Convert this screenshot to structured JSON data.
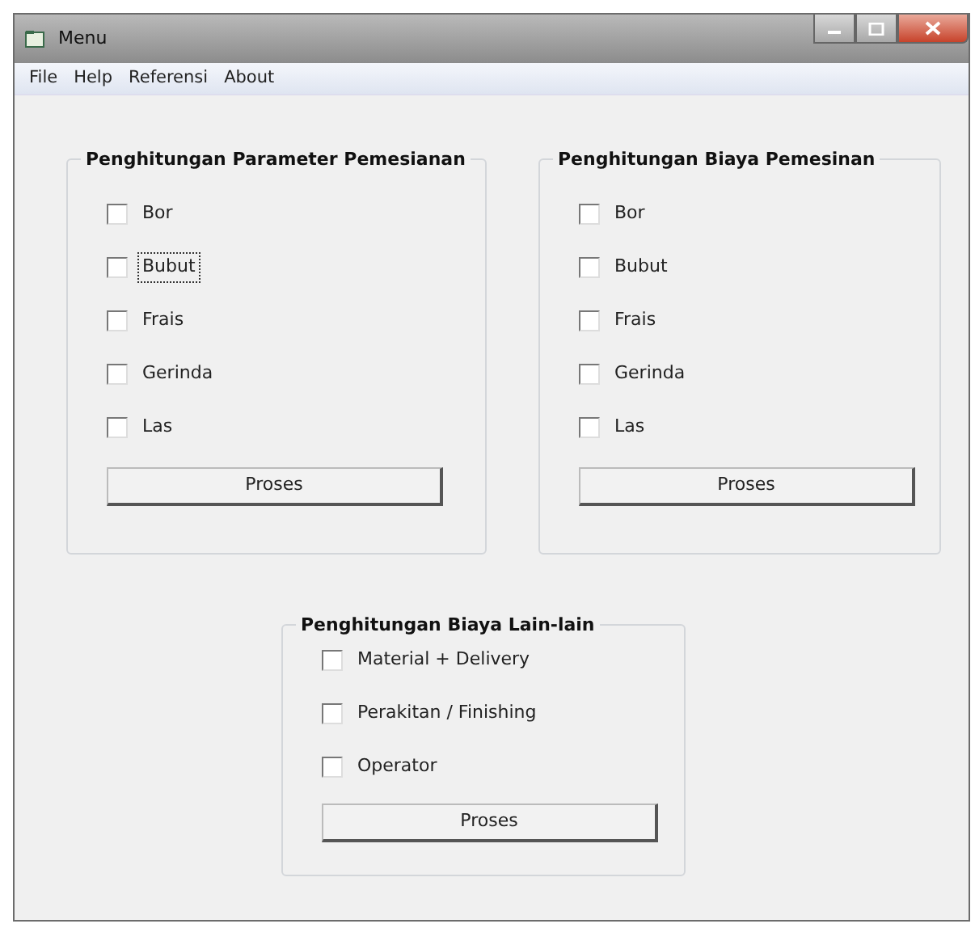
{
  "window": {
    "title": "Menu"
  },
  "menu": [
    "File",
    "Help",
    "Referensi",
    "About"
  ],
  "groups": [
    {
      "title": "Penghitungan Parameter Pemesianan",
      "items": [
        {
          "label": "Bor",
          "checked": false,
          "focused": false
        },
        {
          "label": "Bubut",
          "checked": false,
          "focused": true
        },
        {
          "label": "Frais",
          "checked": false,
          "focused": false
        },
        {
          "label": "Gerinda",
          "checked": false,
          "focused": false
        },
        {
          "label": "Las",
          "checked": false,
          "focused": false
        }
      ],
      "button": "Proses"
    },
    {
      "title": "Penghitungan Biaya Pemesinan",
      "items": [
        {
          "label": "Bor",
          "checked": false,
          "focused": false
        },
        {
          "label": "Bubut",
          "checked": false,
          "focused": false
        },
        {
          "label": "Frais",
          "checked": false,
          "focused": false
        },
        {
          "label": "Gerinda",
          "checked": false,
          "focused": false
        },
        {
          "label": "Las",
          "checked": false,
          "focused": false
        }
      ],
      "button": "Proses"
    },
    {
      "title": "Penghitungan Biaya Lain-lain",
      "items": [
        {
          "label": "Material + Delivery",
          "checked": false,
          "focused": false
        },
        {
          "label": "Perakitan / Finishing",
          "checked": false,
          "focused": false
        },
        {
          "label": "Operator",
          "checked": false,
          "focused": false
        }
      ],
      "button": "Proses"
    }
  ]
}
